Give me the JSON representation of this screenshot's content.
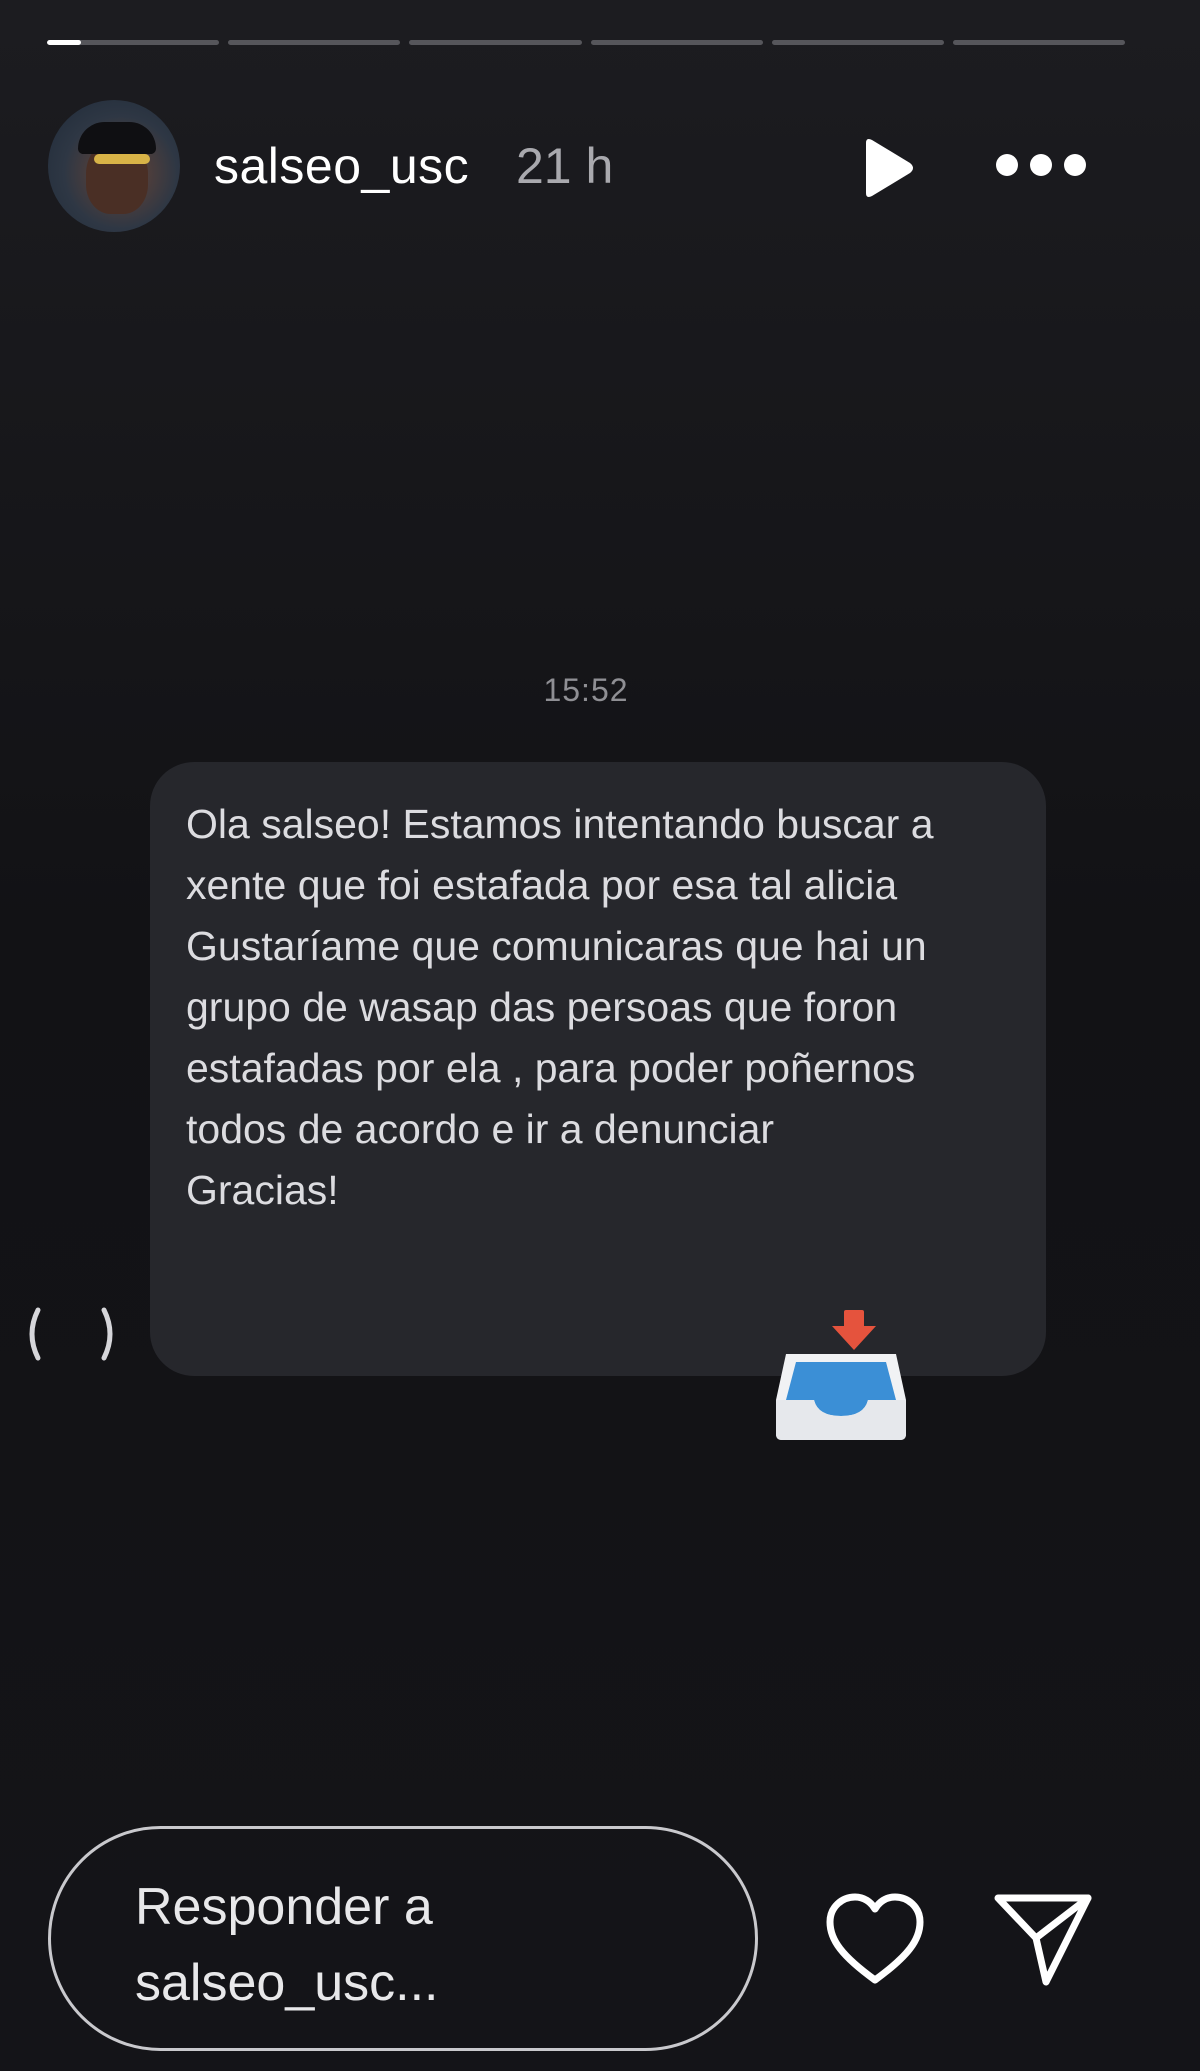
{
  "story": {
    "progress_segments": [
      {
        "fill_fraction": 0.2
      },
      {
        "fill_fraction": 0
      },
      {
        "fill_fraction": 0
      },
      {
        "fill_fraction": 0
      },
      {
        "fill_fraction": 0
      },
      {
        "fill_fraction": 0
      }
    ]
  },
  "header": {
    "username": "salseo_usc",
    "time_ago": "21 h",
    "play_icon": "play-icon",
    "more_icon": "more-horizontal-icon"
  },
  "message": {
    "time": "15:52",
    "text": "Ola salseo! Estamos intentando buscar a xente que foi estafada por esa tal alicia\nGustaríame que comunicaras que hai un grupo de wasap das persoas que foron estafadas por ela , para poder poñernos todos de acordo e ir a denunciar\nGracias!",
    "reaction_icon": "inbox-tray-icon"
  },
  "footer": {
    "reply_placeholder": "Responder a salseo_usc...",
    "like_icon": "heart-icon",
    "send_icon": "send-icon"
  },
  "colors": {
    "background": "#141418",
    "bubble": "#26272c",
    "progress_track": "#56565b",
    "progress_fill": "#ffffff"
  }
}
